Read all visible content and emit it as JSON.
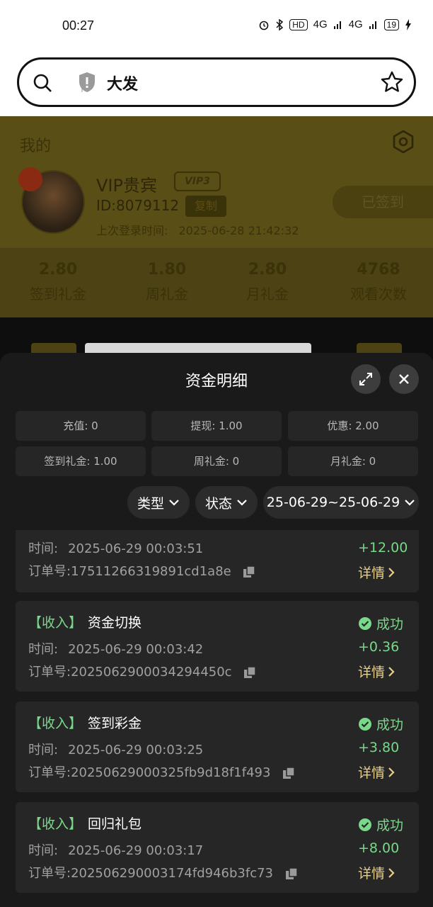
{
  "status_bar": {
    "time": "00:27",
    "hd": "HD",
    "net1": "4G",
    "net2": "4G",
    "battery": "19"
  },
  "browser": {
    "query": "大发"
  },
  "profile": {
    "page_title": "我的",
    "name": "VIP贵宾",
    "vip_badge": "VIP3",
    "id": "ID:8079112",
    "copy_label": "复制",
    "last_login_label": "上次登录时间:",
    "last_login": "2025-06-28 21:42:32",
    "signed_label": "已签到",
    "stats": [
      {
        "value": "2.80",
        "label": "签到礼金"
      },
      {
        "value": "1.80",
        "label": "周礼金"
      },
      {
        "value": "2.80",
        "label": "月礼金"
      },
      {
        "value": "4768",
        "label": "观看次数"
      }
    ]
  },
  "sheet": {
    "title": "资金明细",
    "summary": [
      {
        "text": "充值: 0"
      },
      {
        "text": "提现: 1.00"
      },
      {
        "text": "优惠: 2.00"
      },
      {
        "text": "签到礼金: 1.00"
      },
      {
        "text": "周礼金: 0"
      },
      {
        "text": "月礼金: 0"
      }
    ],
    "filters": {
      "type_label": "类型",
      "status_label": "状态",
      "date_range": "25-06-29~25-06-29"
    },
    "labels": {
      "time": "时间:",
      "order": "订单号:",
      "detail": "详情"
    },
    "records": [
      {
        "tag": "",
        "name": "",
        "status": "",
        "time": "2025-06-29 00:03:51",
        "order": "17511266319891cd1a8e",
        "amount": "+12.00"
      },
      {
        "tag": "【收入】",
        "name": "资金切换",
        "status": "成功",
        "time": "2025-06-29 00:03:42",
        "order": "2025062900034294450c",
        "amount": "+0.36"
      },
      {
        "tag": "【收入】",
        "name": "签到彩金",
        "status": "成功",
        "time": "2025-06-29 00:03:25",
        "order": "20250629000325fb9d18f1f493",
        "amount": "+3.80"
      },
      {
        "tag": "【收入】",
        "name": "回归礼包",
        "status": "成功",
        "time": "2025-06-29 00:03:17",
        "order": "202506290003174fd946b3fc73",
        "amount": "+8.00"
      }
    ]
  },
  "colors": {
    "accent_green": "#7ad88a",
    "detail_gold": "#e7cf8a",
    "sheet_bg": "#1a1a1a"
  }
}
